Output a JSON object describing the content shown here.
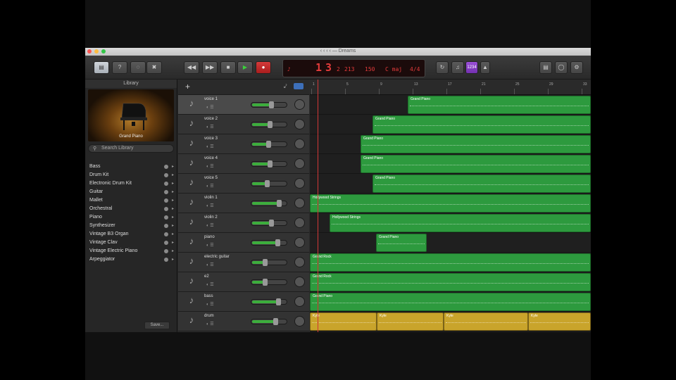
{
  "window": {
    "title": "‹ ‹ ‹ ‹ — Dreams"
  },
  "toolbar": {
    "lcd": {
      "bar": "1",
      "beat": "3",
      "div": "2",
      "tick": "213",
      "tempo": "150",
      "key": "C maj",
      "sig": "4/4"
    },
    "zoom_label": "1234"
  },
  "library": {
    "header": "Library",
    "patch_name": "Grand Piano",
    "search_placeholder": "Search Library",
    "categories": [
      "Bass",
      "Drum Kit",
      "Electronic Drum Kit",
      "Guitar",
      "Mallet",
      "Orchestral",
      "Piano",
      "Synthesizer",
      "Vintage B3 Organ",
      "Vintage Clav",
      "Vintage Electric Piano",
      "Arpeggiator"
    ],
    "save_label": "Save..."
  },
  "tracks": [
    {
      "name": "voice 1",
      "icon": "mic-icon",
      "vol": 0.55
    },
    {
      "name": "voice 2",
      "icon": "mic-icon",
      "vol": 0.5
    },
    {
      "name": "voice 3",
      "icon": "mic-icon",
      "vol": 0.47
    },
    {
      "name": "voice 4",
      "icon": "mic-icon",
      "vol": 0.52
    },
    {
      "name": "voice 5",
      "icon": "mic-icon",
      "vol": 0.43
    },
    {
      "name": "violin 1",
      "icon": "violin-icon",
      "vol": 0.8
    },
    {
      "name": "violin 2",
      "icon": "violin-icon",
      "vol": 0.55
    },
    {
      "name": "piano",
      "icon": "piano-icon",
      "vol": 0.75
    },
    {
      "name": "electric guitar",
      "icon": "guitar-icon",
      "vol": 0.35
    },
    {
      "name": "e2",
      "icon": "guitar-icon",
      "vol": 0.35
    },
    {
      "name": "bass",
      "icon": "bass-icon",
      "vol": 0.78
    },
    {
      "name": "drum",
      "icon": "drum-icon",
      "vol": 0.68
    }
  ],
  "ruler": [
    "1",
    "5",
    "9",
    "13",
    "17",
    "21",
    "25",
    "29",
    "33"
  ],
  "regions": [
    {
      "lane": 0,
      "start": 139,
      "end": 399,
      "name": "Grand Piano",
      "type": "midi"
    },
    {
      "lane": 1,
      "start": 89,
      "end": 399,
      "name": "Grand Piano",
      "type": "midi"
    },
    {
      "lane": 2,
      "start": 72,
      "end": 399,
      "name": "Grand Piano",
      "type": "midi"
    },
    {
      "lane": 3,
      "start": 72,
      "end": 399,
      "name": "Grand Piano",
      "type": "midi"
    },
    {
      "lane": 4,
      "start": 89,
      "end": 399,
      "name": "Grand Piano",
      "type": "midi"
    },
    {
      "lane": 5,
      "start": 0,
      "end": 399,
      "name": "Hollywood Strings",
      "type": "midi"
    },
    {
      "lane": 6,
      "start": 28,
      "end": 399,
      "name": "Hollywood Strings",
      "type": "midi"
    },
    {
      "lane": 7,
      "start": 94,
      "end": 166,
      "name": "Grand Piano",
      "type": "midi"
    },
    {
      "lane": 8,
      "start": 0,
      "end": 399,
      "name": "Grand Rock",
      "type": "midi"
    },
    {
      "lane": 9,
      "start": 0,
      "end": 399,
      "name": "Grand Rock",
      "type": "midi"
    },
    {
      "lane": 10,
      "start": 0,
      "end": 399,
      "name": "Grand Piano",
      "type": "midi"
    },
    {
      "lane": 11,
      "start": 0,
      "end": 95,
      "name": "Kyle",
      "type": "drum"
    },
    {
      "lane": 11,
      "start": 95,
      "end": 190,
      "name": "Kyle",
      "type": "drum"
    },
    {
      "lane": 11,
      "start": 190,
      "end": 310,
      "name": "Kyle",
      "type": "drum"
    },
    {
      "lane": 11,
      "start": 310,
      "end": 399,
      "name": "Kyle",
      "type": "drum"
    }
  ]
}
